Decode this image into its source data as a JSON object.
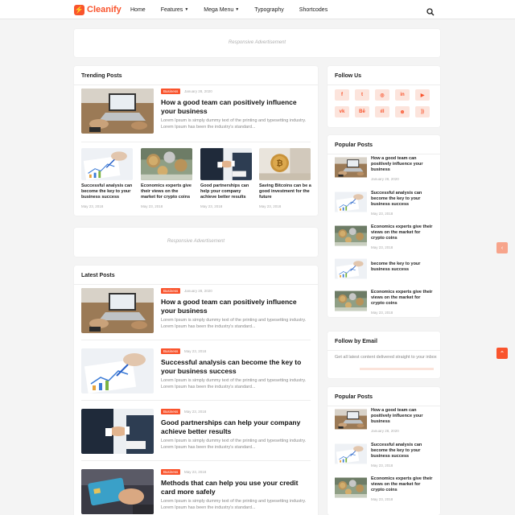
{
  "brand": {
    "name": "Cleanify",
    "accent": "#f9542d"
  },
  "nav": {
    "home": "Home",
    "features": "Features",
    "mega_menu": "Mega Menu",
    "typography": "Typography",
    "shortcodes": "Shortcodes"
  },
  "ads": {
    "top": "Responsive Advertisement",
    "middle": "Responsive Advertisement"
  },
  "trending": {
    "title": "Trending Posts",
    "featured": {
      "tag": "Business",
      "date": "January 28, 2020",
      "title": "How a good team can positively influence your business",
      "excerpt": "Lorem Ipsum is simply dummy text of the printing and typesetting industry. Lorem Ipsum has been the industry's standard..."
    },
    "items": [
      {
        "title": "Successful analysis can become the key to your business success",
        "date": "May 23, 2018"
      },
      {
        "title": "Economics experts give their views on the market for crypto coins",
        "date": "May 23, 2018"
      },
      {
        "title": "Good partnerships can help your company achieve better results",
        "date": "May 23, 2018"
      },
      {
        "title": "Saving Bitcoins can be a good investment for the future",
        "date": "May 23, 2018"
      }
    ]
  },
  "latest": {
    "title": "Latest Posts",
    "posts": [
      {
        "tag": "Business",
        "date": "January 28, 2020",
        "title": "How a good team can positively influence your business",
        "excerpt": "Lorem Ipsum is simply dummy text of the printing and typesetting industry. Lorem Ipsum has been the industry's standard..."
      },
      {
        "tag": "Business",
        "date": "May 23, 2018",
        "title": "Successful analysis can become the key to your business success",
        "excerpt": "Lorem Ipsum is simply dummy text of the printing and typesetting industry. Lorem Ipsum has been the industry's standard..."
      },
      {
        "tag": "Business",
        "date": "May 23, 2018",
        "title": "Good partnerships can help your company achieve better results",
        "excerpt": "Lorem Ipsum is simply dummy text of the printing and typesetting industry. Lorem Ipsum has been the industry's standard..."
      },
      {
        "tag": "Business",
        "date": "May 23, 2018",
        "title": "Methods that can help you use your credit card more safely",
        "excerpt": "Lorem Ipsum is simply dummy text of the printing and typesetting industry. Lorem Ipsum has been the industry's standard..."
      }
    ]
  },
  "follow_us": {
    "title": "Follow Us",
    "icons": [
      {
        "name": "facebook-icon",
        "glyph": "f"
      },
      {
        "name": "twitter-icon",
        "glyph": "t"
      },
      {
        "name": "instagram-icon",
        "glyph": "◎"
      },
      {
        "name": "linkedin-icon",
        "glyph": "in"
      },
      {
        "name": "youtube-icon",
        "glyph": "▶"
      },
      {
        "name": "vk-icon",
        "glyph": "vk"
      },
      {
        "name": "behance-icon",
        "glyph": "Bē"
      },
      {
        "name": "soundcloud-icon",
        "glyph": "ıll"
      },
      {
        "name": "dribbble-icon",
        "glyph": "⊛"
      },
      {
        "name": "rss-icon",
        "glyph": "))"
      }
    ]
  },
  "popular1": {
    "title": "Popular Posts",
    "items": [
      {
        "title": "How a good team can positively influence your business",
        "date": "January 28, 2020"
      },
      {
        "title": "Successful analysis can become the key to your business success",
        "date": "May 23, 2018"
      },
      {
        "title": "Economics experts give their views on the market for crypto coins",
        "date": "May 23, 2018"
      },
      {
        "title": "become the key to your business success",
        "date": ""
      },
      {
        "title": "Economics experts give their views on the market for crypto coins",
        "date": "May 23, 2018"
      }
    ]
  },
  "follow_email": {
    "title": "Follow by Email",
    "text": "Get all latest content delivered straight to your inbox"
  },
  "popular2": {
    "title": "Popular Posts",
    "items": [
      {
        "title": "How a good team can positively influence your business",
        "date": "January 28, 2020"
      },
      {
        "title": "Successful analysis can become the key to your business success",
        "date": "May 23, 2018"
      },
      {
        "title": "Economics experts give their views on the market for crypto coins",
        "date": "May 23, 2018"
      }
    ]
  }
}
